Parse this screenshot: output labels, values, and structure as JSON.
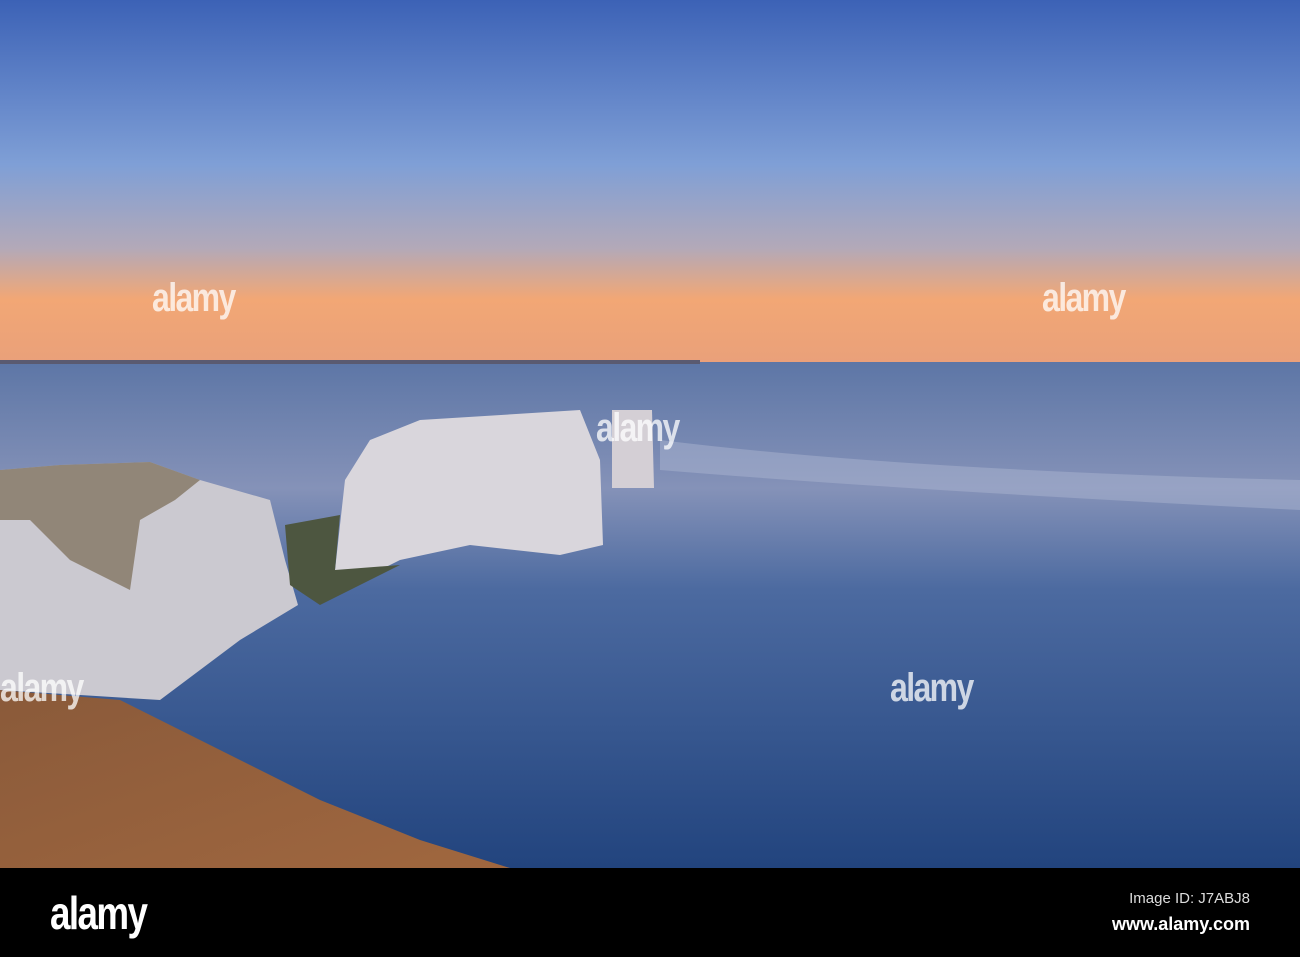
{
  "watermark": {
    "text": "alamy"
  },
  "footer": {
    "logo": "alamy",
    "image_id": "Image ID: J7ABJ8",
    "website": "www.alamy.com"
  },
  "colors": {
    "sky_top": "#3d63b5",
    "horizon_glow": "#f5a570",
    "sea": "#2f4f8a",
    "footer": "#000000"
  }
}
